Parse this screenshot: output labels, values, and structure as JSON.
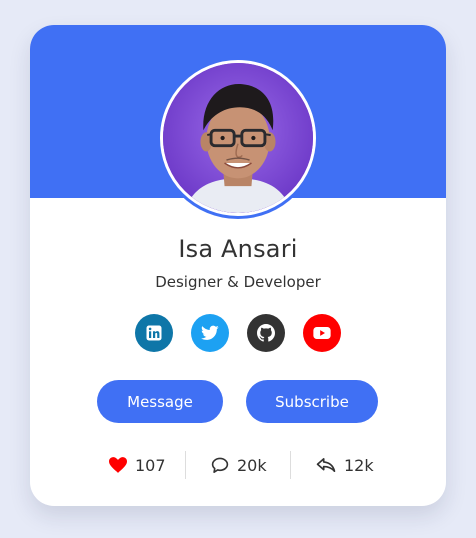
{
  "profile": {
    "name": "Isa Ansari",
    "title": "Designer & Developer",
    "avatar_alt": "profile-photo"
  },
  "socials": [
    {
      "network": "linkedin",
      "icon": "linkedin-icon",
      "color": "#0e76a8"
    },
    {
      "network": "twitter",
      "icon": "twitter-icon",
      "color": "#1da1f2"
    },
    {
      "network": "github",
      "icon": "github-icon",
      "color": "#333333"
    },
    {
      "network": "youtube",
      "icon": "youtube-icon",
      "color": "#ff0000"
    }
  ],
  "buttons": {
    "message_label": "Message",
    "subscribe_label": "Subscribe"
  },
  "stats": {
    "likes": "107",
    "comments": "20k",
    "shares": "12k"
  },
  "colors": {
    "accent": "#4070f4",
    "like_heart": "#ff0000",
    "text": "#333333"
  }
}
